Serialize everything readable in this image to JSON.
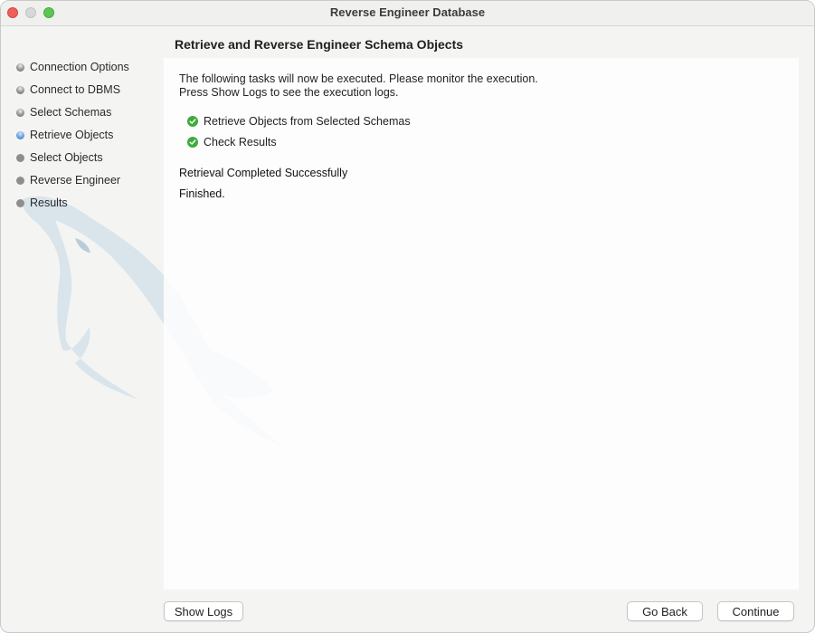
{
  "window": {
    "title": "Reverse Engineer Database"
  },
  "sidebar": {
    "steps": [
      {
        "label": "Connection Options",
        "state": "done"
      },
      {
        "label": "Connect to DBMS",
        "state": "done"
      },
      {
        "label": "Select Schemas",
        "state": "done"
      },
      {
        "label": "Retrieve Objects",
        "state": "active"
      },
      {
        "label": "Select Objects",
        "state": "pending"
      },
      {
        "label": "Reverse Engineer",
        "state": "pending"
      },
      {
        "label": "Results",
        "state": "pending"
      }
    ]
  },
  "main": {
    "heading": "Retrieve and Reverse Engineer Schema Objects",
    "intro_line1": "The following tasks will now be executed. Please monitor the execution.",
    "intro_line2": "Press Show Logs to see the execution logs.",
    "tasks": [
      {
        "label": "Retrieve Objects from Selected Schemas",
        "status": "completed"
      },
      {
        "label": "Check Results",
        "status": "completed"
      }
    ],
    "status_message": "Retrieval Completed Successfully",
    "finished_message": "Finished."
  },
  "footer": {
    "show_logs_label": "Show Logs",
    "go_back_label": "Go Back",
    "continue_label": "Continue"
  },
  "colors": {
    "check_green": "#3cab3c",
    "active_step_blue": "#6fa5dd",
    "close": "#ee5f57",
    "maximize": "#5fc454"
  },
  "icons": [
    "close-button",
    "minimize-button",
    "maximize-button",
    "step-status-dot",
    "check-circle-icon",
    "dolphin-watermark"
  ]
}
